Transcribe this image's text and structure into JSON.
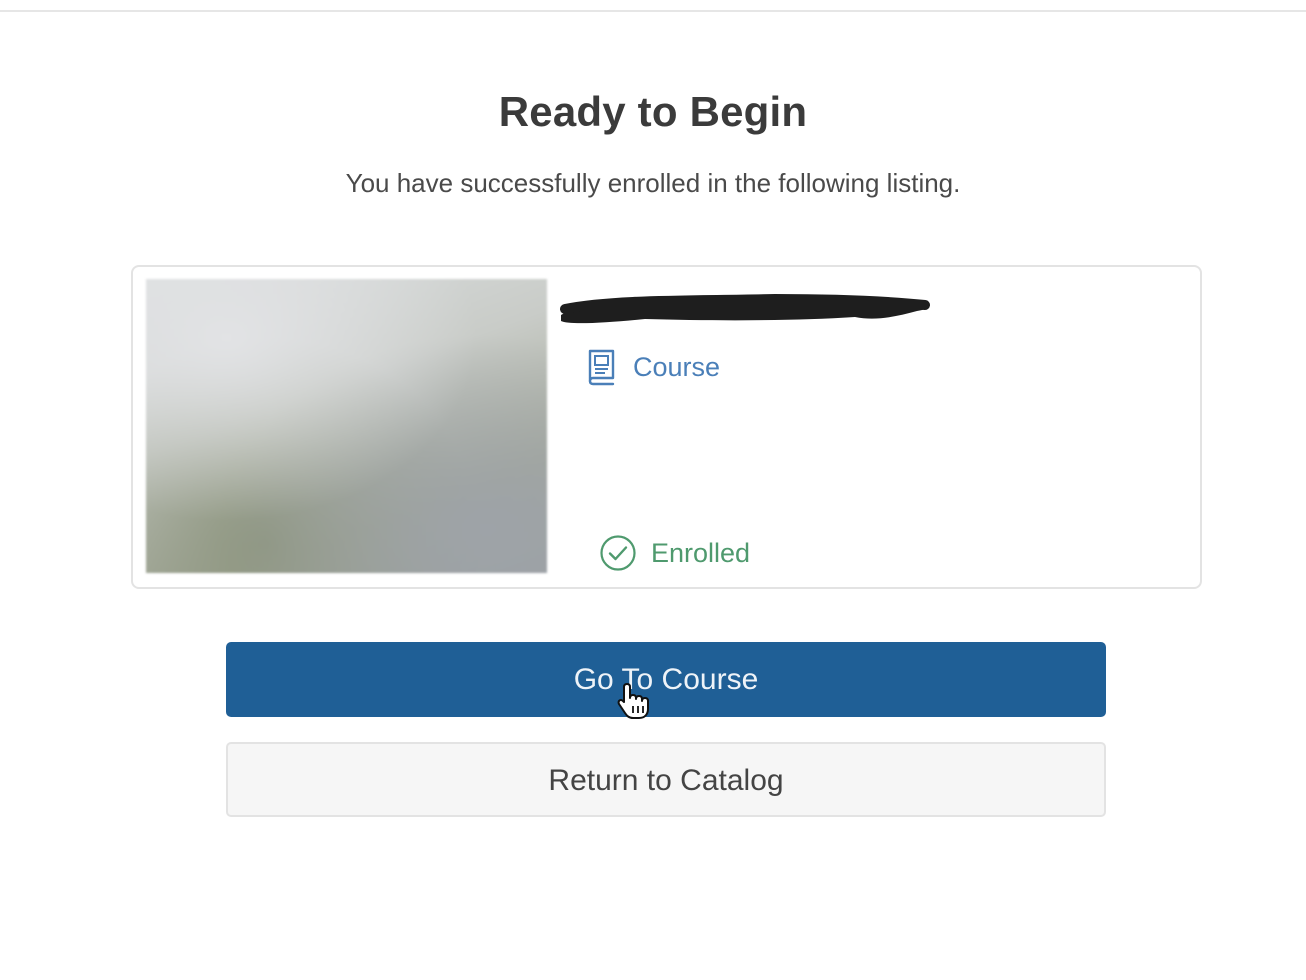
{
  "header": {
    "title": "Ready to Begin",
    "subtitle": "You have successfully enrolled in the following listing."
  },
  "listing": {
    "type_label": "Course",
    "type_icon": "book-icon",
    "status_label": "Enrolled",
    "status_icon": "check-circle-icon",
    "title_redacted": true
  },
  "actions": {
    "primary_label": "Go To Course",
    "secondary_label": "Return to Catalog"
  },
  "colors": {
    "primary_button": "#1f5f96",
    "type_accent": "#4a7fb8",
    "status_accent": "#4f9a6e"
  }
}
